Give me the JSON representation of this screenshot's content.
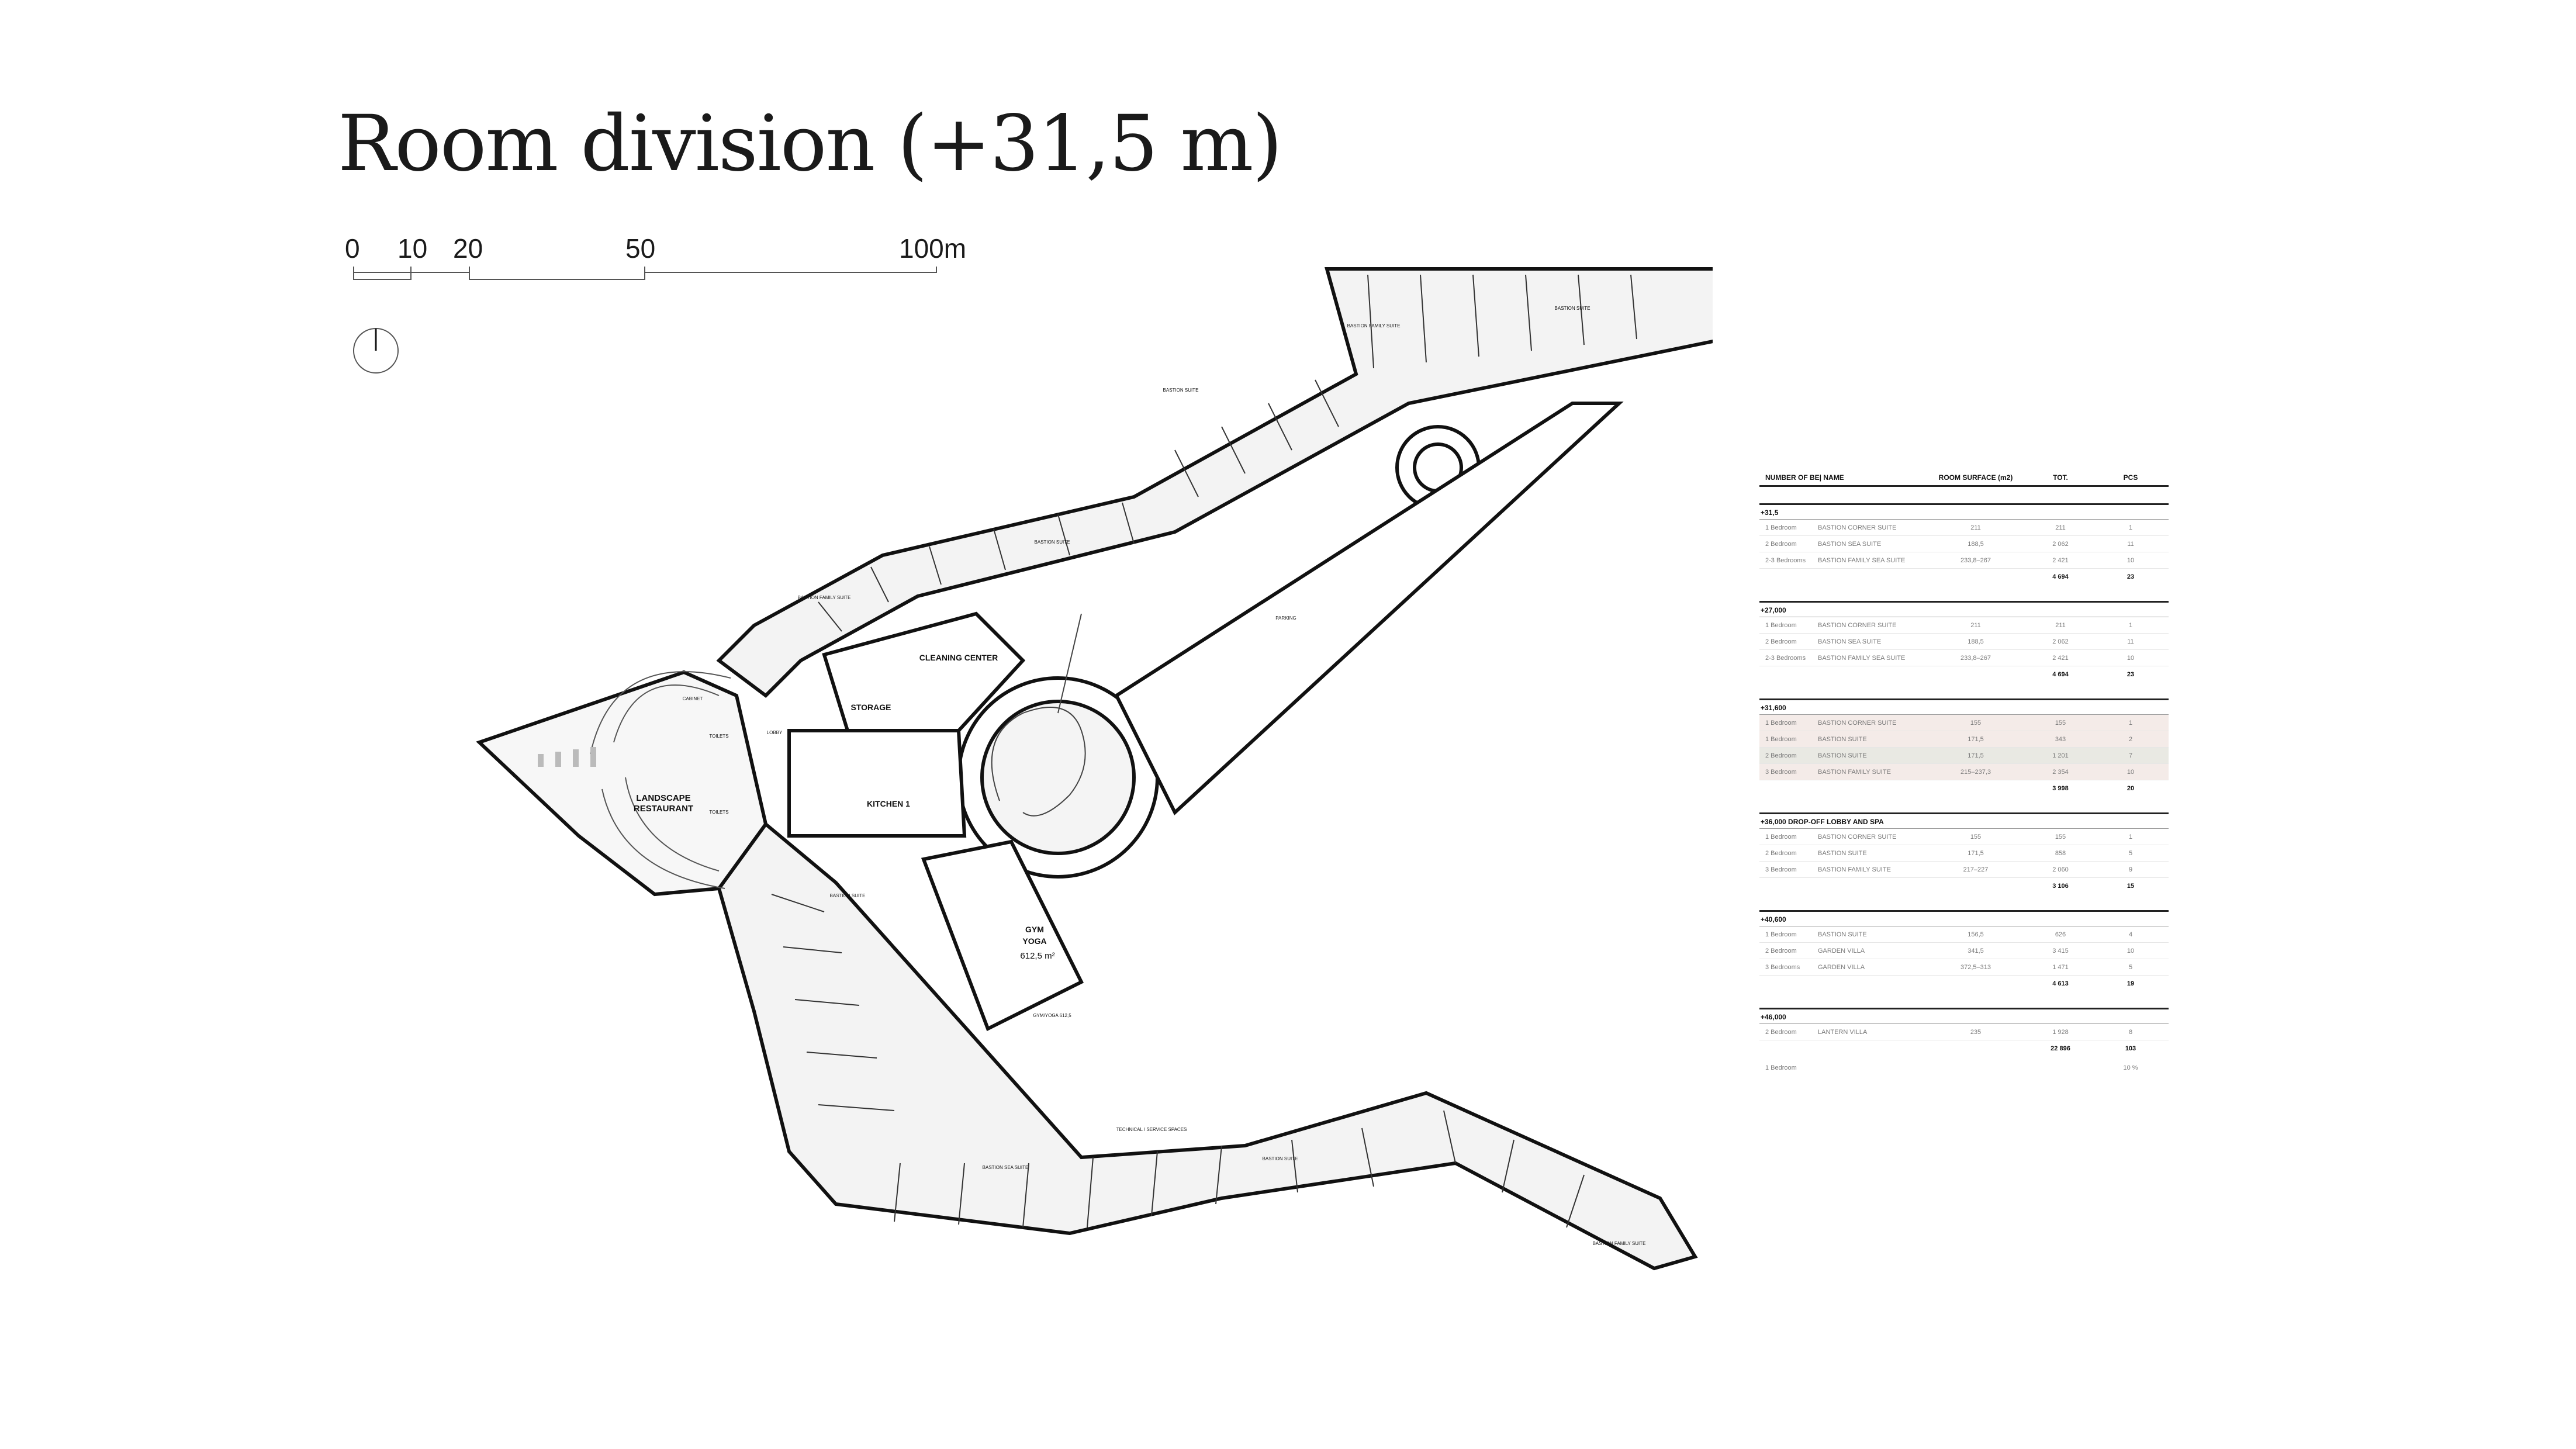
{
  "title": "Room division (+31,5 m)",
  "scale": {
    "ticks": [
      "0",
      "10",
      "20",
      "50",
      "100m"
    ]
  },
  "plan": {
    "labels": {
      "cleaning_center": "CLEANING CENTER",
      "storage": "STORAGE",
      "kitchen": "KITCHEN 1",
      "gym": "GYM",
      "yoga": "YOGA",
      "gym_area": "612,5 m²",
      "restaurant_1": "LANDSCAPE",
      "restaurant_2": "RESTAURANT",
      "cabinet": "CABINET",
      "toilets_a": "TOILETS",
      "toilets_b": "TOILETS",
      "lobby": "LOBBY",
      "parking": "PARKING",
      "gym_yoga_small": "GYM/YOGA 612,5",
      "technical": "TECHNICAL / SERVICE SPACES",
      "suite": "BASTION SUITE",
      "family_suite": "BASTION FAMILY SUITE",
      "sea_suite": "BASTION SEA SUITE"
    }
  },
  "table": {
    "headers": [
      "NUMBER OF BE| NAME",
      "ROOM SURFACE (m2)",
      "TOT.",
      "PCS"
    ],
    "sections": [
      {
        "title": "+31,5",
        "rows": [
          [
            "1 Bedroom",
            "BASTION CORNER SUITE",
            "211",
            "211",
            "1"
          ],
          [
            "2 Bedroom",
            "BASTION SEA SUITE",
            "188,5",
            "2 062",
            "11"
          ],
          [
            "2-3 Bedrooms",
            "BASTION FAMILY SEA SUITE",
            "233,8–267",
            "2 421",
            "10"
          ]
        ],
        "total": [
          "4 694",
          "23"
        ]
      },
      {
        "title": "+27,000",
        "rows": [
          [
            "1 Bedroom",
            "BASTION CORNER SUITE",
            "211",
            "211",
            "1"
          ],
          [
            "2 Bedroom",
            "BASTION SEA SUITE",
            "188,5",
            "2 062",
            "11"
          ],
          [
            "2-3 Bedrooms",
            "BASTION FAMILY SEA SUITE",
            "233,8–267",
            "2 421",
            "10"
          ]
        ],
        "total": [
          "4 694",
          "23"
        ]
      },
      {
        "title": "+31,600",
        "rows": [
          [
            "1 Bedroom",
            "BASTION CORNER SUITE",
            "155",
            "155",
            "1"
          ],
          [
            "1 Bedroom",
            "BASTION SUITE",
            "171,5",
            "343",
            "2"
          ],
          [
            "2 Bedroom",
            "BASTION SUITE",
            "171,5",
            "1 201",
            "7"
          ],
          [
            "3 Bedroom",
            "BASTION FAMILY SUITE",
            "215–237,3",
            "2 354",
            "10"
          ]
        ],
        "total": [
          "3 998",
          "20"
        ]
      },
      {
        "title": "+36,000 DROP-OFF LOBBY AND SPA",
        "rows": [
          [
            "1 Bedroom",
            "BASTION CORNER SUITE",
            "155",
            "155",
            "1"
          ],
          [
            "2 Bedroom",
            "BASTION SUITE",
            "171,5",
            "858",
            "5"
          ],
          [
            "3 Bedroom",
            "BASTION FAMILY SUITE",
            "217–227",
            "2 060",
            "9"
          ]
        ],
        "total": [
          "3 106",
          "15"
        ]
      },
      {
        "title": "+40,600",
        "rows": [
          [
            "1 Bedroom",
            "BASTION SUITE",
            "156,5",
            "626",
            "4"
          ],
          [
            "2 Bedroom",
            "GARDEN VILLA",
            "341,5",
            "3 415",
            "10"
          ],
          [
            "3 Bedrooms",
            "GARDEN VILLA",
            "372,5–313",
            "1 471",
            "5"
          ]
        ],
        "total": [
          "4 613",
          "19"
        ]
      },
      {
        "title": "+46,000",
        "rows": [
          [
            "2 Bedroom",
            "LANTERN VILLA",
            "235",
            "1 928",
            "8"
          ]
        ],
        "total": [
          "22 896",
          "103"
        ]
      }
    ],
    "footer": [
      "1 Bedroom",
      "10 %"
    ]
  },
  "colors": {
    "ink": "#111111",
    "room_fill": "#e8e8e8",
    "highlight_row": "#e9e9e3",
    "accent_blue": "#3355cc"
  }
}
